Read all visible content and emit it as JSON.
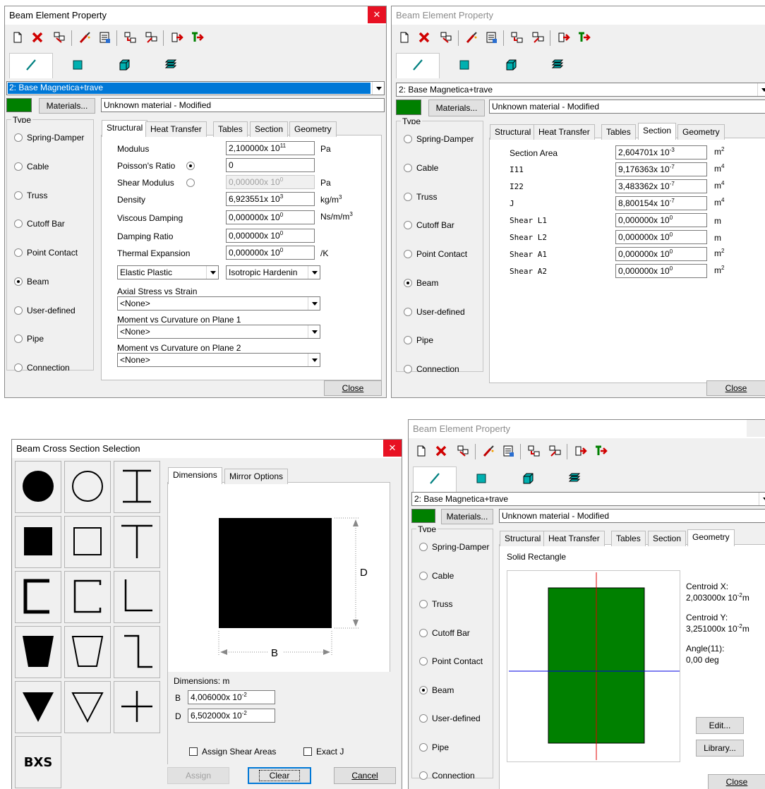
{
  "colors": {
    "material_swatch": "#008000",
    "section_fill": "#008000",
    "axis_vertical": "#e00000",
    "axis_horizontal": "#0000e0",
    "close_active": "#e81123"
  },
  "dialog_title": "Beam Element Property",
  "element_types": {
    "line": "line-element-icon",
    "plate": "plate-element-icon",
    "brick": "brick-element-icon",
    "shell": "stacked-element-icon"
  },
  "part_selector_value": "2: Base Magnetica+trave",
  "materials_button": "Materials...",
  "material_name": "Unknown material - Modified",
  "type_group_title": "Type",
  "type_options": [
    "Spring-Damper",
    "Cable",
    "Truss",
    "Cutoff Bar",
    "Point Contact",
    "Beam",
    "User-defined",
    "Pipe",
    "Connection"
  ],
  "selected_type": "Beam",
  "tabs": [
    "Structural",
    "Heat Transfer",
    "Tables",
    "Section",
    "Geometry"
  ],
  "close_label": "Close",
  "structural": {
    "modulus_label": "Modulus",
    "modulus_mant": "2,100000x 10",
    "modulus_exp": "11",
    "modulus_unit": "Pa",
    "poisson_label": "Poisson's Ratio",
    "poisson_value": "0",
    "shear_label": "Shear Modulus",
    "shear_mant": "0,000000x 10",
    "shear_exp": "0",
    "shear_unit": "Pa",
    "density_label": "Density",
    "density_mant": "6,923551x 10",
    "density_exp": "3",
    "density_unit_base": "kg/m",
    "density_unit_exp": "3",
    "visc_label": "Viscous Damping",
    "visc_mant": "0,000000x 10",
    "visc_exp": "0",
    "visc_unit_base": "Ns/m/m",
    "visc_unit_exp": "3",
    "damp_label": "Damping Ratio",
    "damp_mant": "0,000000x 10",
    "damp_exp": "0",
    "therm_label": "Thermal Expansion",
    "therm_mant": "0,000000x 10",
    "therm_exp": "0",
    "therm_unit": "/K",
    "plastic_model": "Elastic Plastic",
    "hardening_model": "Isotropic Hardenin",
    "axial_label": "Axial Stress vs Strain",
    "axial_value": "<None>",
    "plane1_label": "Moment vs Curvature on Plane 1",
    "plane1_value": "<None>",
    "plane2_label": "Moment vs Curvature on Plane 2",
    "plane2_value": "<None>"
  },
  "section": {
    "area_label": "Section Area",
    "area_mant": "2,604701x 10",
    "area_exp": "-3",
    "area_unit_exp": "2",
    "i11_label": "I11",
    "i11_mant": "9,176363x 10",
    "i11_exp": "-7",
    "i11_unit_exp": "4",
    "i22_label": "I22",
    "i22_mant": "3,483362x 10",
    "i22_exp": "-7",
    "i22_unit_exp": "4",
    "j_label": "J",
    "j_mant": "8,800154x 10",
    "j_exp": "-7",
    "j_unit_exp": "4",
    "sl1_label": "Shear L1",
    "sl1_mant": "0,000000x 10",
    "sl1_exp": "0",
    "sl2_label": "Shear L2",
    "sl2_mant": "0,000000x 10",
    "sl2_exp": "0",
    "sa1_label": "Shear A1",
    "sa1_mant": "0,000000x 10",
    "sa1_exp": "0",
    "sa1_unit_exp": "2",
    "sa2_label": "Shear A2",
    "sa2_mant": "0,000000x 10",
    "sa2_exp": "0",
    "sa2_unit_exp": "2",
    "unit_m": "m"
  },
  "cross_section": {
    "title": "Beam Cross Section Selection",
    "tabs": [
      "Dimensions",
      "Mirror Options"
    ],
    "dim_b": "B",
    "dim_d": "D",
    "dims_label": "Dimensions: m",
    "b_label": "B",
    "b_mant": "4,006000x 10",
    "b_exp": "-2",
    "d_label": "D",
    "d_mant": "6,502000x 10",
    "d_exp": "-2",
    "assign_shear": "Assign Shear Areas",
    "exact_j": "Exact J",
    "assign_btn": "Assign",
    "clear_btn": "Clear",
    "cancel_btn": "Cancel",
    "shapes": [
      "solid-circle-icon",
      "hollow-circle-icon",
      "i-beam-icon",
      "solid-square-icon",
      "hollow-square-icon",
      "tee-icon",
      "channel-icon",
      "lipped-channel-icon",
      "angle-icon",
      "solid-trapezoid-icon",
      "hollow-trapezoid-icon",
      "zee-icon",
      "solid-triangle-icon",
      "hollow-triangle-icon",
      "cross-icon"
    ],
    "bxs_label": "BXS"
  },
  "geometry": {
    "shape_name": "Solid Rectangle",
    "cx_label": "Centroid X:",
    "cx_mant": "2,003000x 10",
    "cx_exp": "-2",
    "cx_unit": "m",
    "cy_label": "Centroid Y:",
    "cy_mant": "3,251000x 10",
    "cy_exp": "-2",
    "cy_unit": "m",
    "angle_label": "Angle(11):",
    "angle_value": "0,00 deg",
    "edit_btn": "Edit...",
    "library_btn": "Library..."
  }
}
